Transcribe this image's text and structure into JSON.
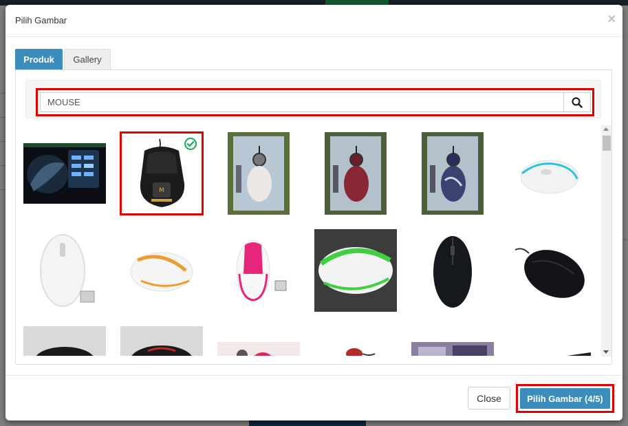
{
  "modal": {
    "title": "Pilih Gambar",
    "close_glyph": "×"
  },
  "tabs": [
    {
      "label": "Produk",
      "active": true
    },
    {
      "label": "Gallery",
      "active": false
    }
  ],
  "search": {
    "value": "MOUSE",
    "icon": "search-icon"
  },
  "thumbnails": {
    "selected_index": 1,
    "selected_icon": "check-circle-icon",
    "items": [
      {
        "kind": "gaming-mousepad"
      },
      {
        "kind": "black-gaming-mouse",
        "selected": true
      },
      {
        "kind": "retractable-mouse-white-pack"
      },
      {
        "kind": "retractable-mouse-red-pack"
      },
      {
        "kind": "retractable-mouse-blue-pack"
      },
      {
        "kind": "white-cyan-mouse"
      },
      {
        "kind": "white-wireless-mouse"
      },
      {
        "kind": "white-orange-mouse"
      },
      {
        "kind": "white-pink-mouse"
      },
      {
        "kind": "white-green-mouse"
      },
      {
        "kind": "black-logitech-mouse"
      },
      {
        "kind": "black-logitech-mouse-side"
      },
      {
        "kind": "black-mouse-partial"
      },
      {
        "kind": "black-red-mouse-partial"
      },
      {
        "kind": "retractable-mouse-partial"
      },
      {
        "kind": "red-retractable-mouse-partial"
      },
      {
        "kind": "mouse-packaging-partial"
      },
      {
        "kind": "keyboard-partial"
      }
    ]
  },
  "footer": {
    "close_label": "Close",
    "pick_label": "Pilih Gambar (4/5)"
  },
  "colors": {
    "accent": "#3c8dbc",
    "highlight": "#e00000",
    "check": "#27ae60"
  }
}
